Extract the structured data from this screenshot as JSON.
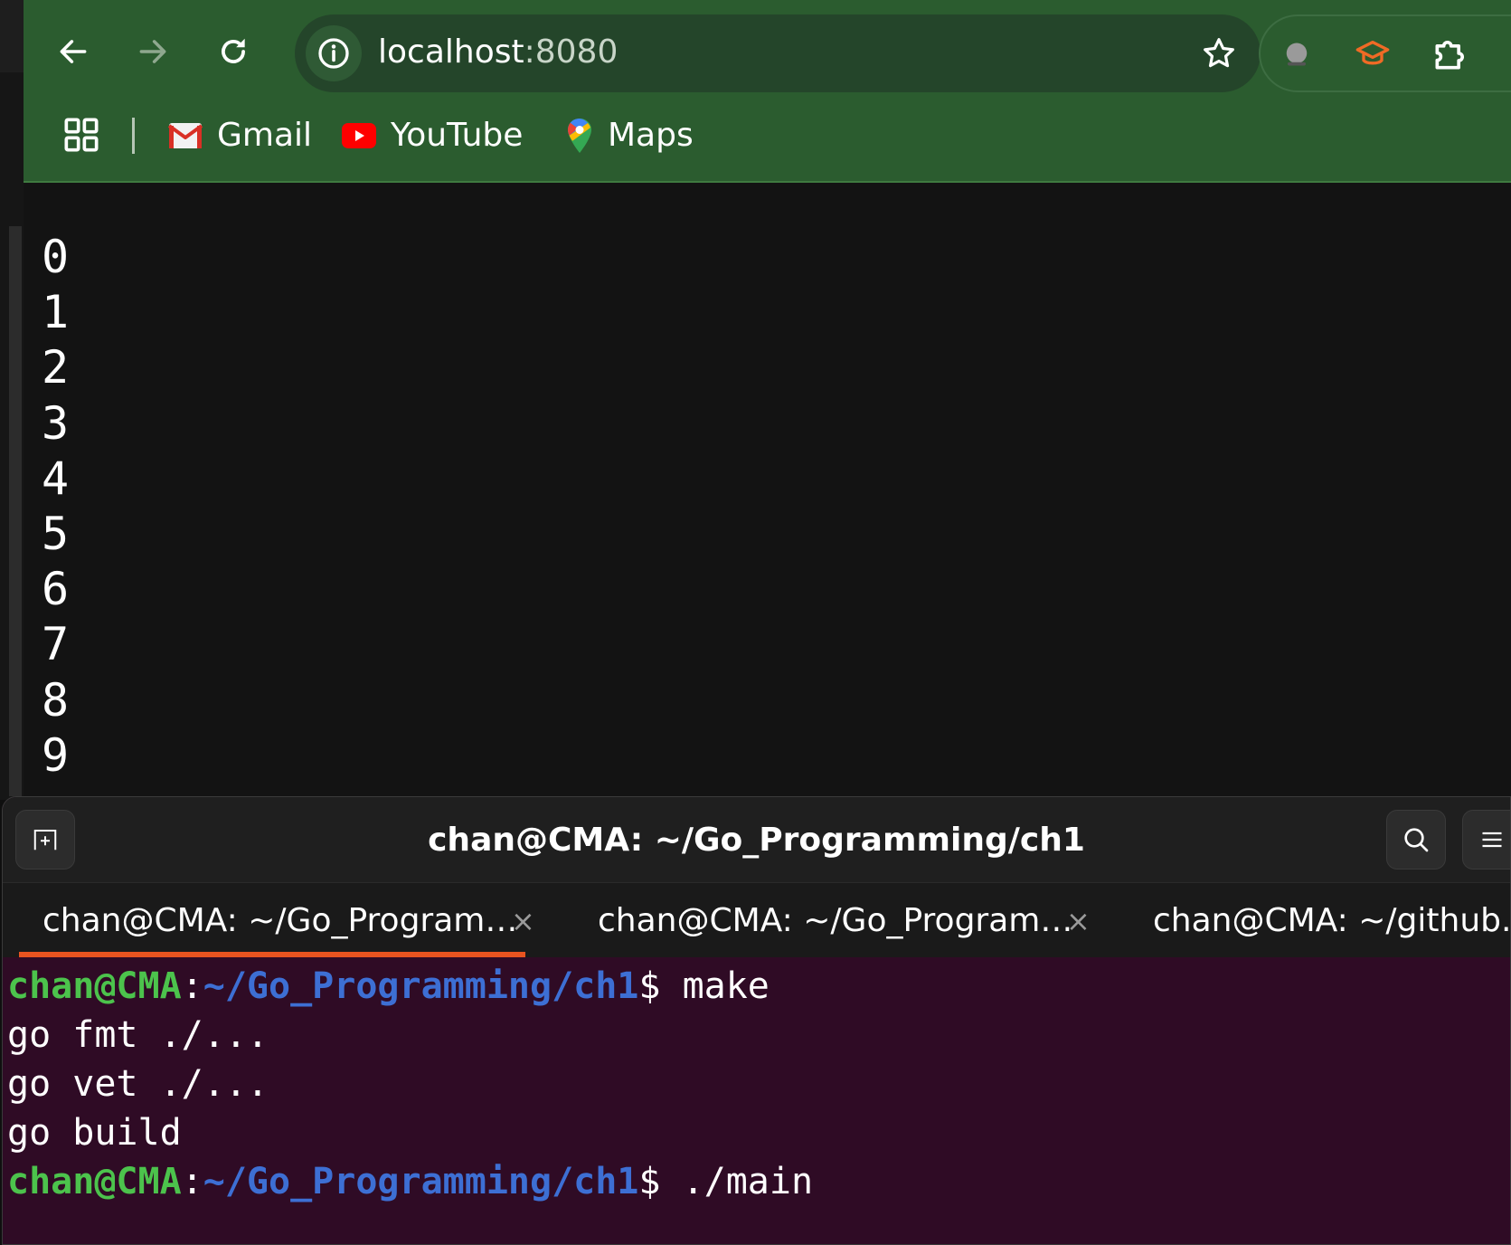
{
  "browser": {
    "address": {
      "host": "localhost",
      "port": ":8080"
    },
    "bookmarks": [
      {
        "label": "Gmail",
        "icon": "gmail-icon"
      },
      {
        "label": "YouTube",
        "icon": "youtube-icon"
      },
      {
        "label": "Maps",
        "icon": "maps-icon"
      }
    ],
    "toolbar_color": "#2b5c2f",
    "page_lines": [
      "0",
      "1",
      "2",
      "3",
      "4",
      "5",
      "6",
      "7",
      "8",
      "9"
    ]
  },
  "terminal": {
    "title": "chan@CMA: ~/Go_Programming/ch1",
    "tabs": [
      {
        "label": "chan@CMA: ~/Go_Program…",
        "active": true
      },
      {
        "label": "chan@CMA: ~/Go_Program…",
        "active": false
      },
      {
        "label": "chan@CMA: ~/github.com",
        "active": false
      }
    ],
    "prompt": {
      "user": "chan@CMA",
      "colon": ":",
      "path": "~/Go_Programming/ch1",
      "dollar": "$ "
    },
    "commands": {
      "first": "make",
      "second": "./main"
    },
    "output": [
      "go fmt ./...",
      "go vet ./...",
      "go build"
    ],
    "accent_color": "#e95420",
    "background_color": "#2f0b25"
  }
}
